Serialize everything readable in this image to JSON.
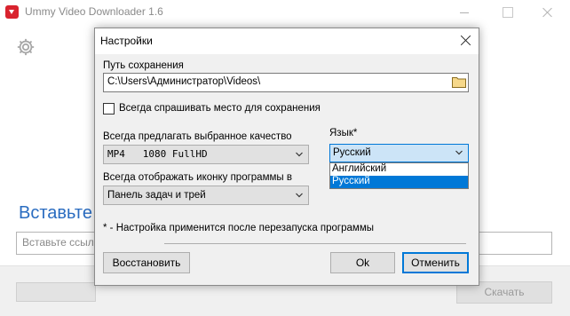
{
  "main_window": {
    "title": "Ummy Video Downloader 1.6",
    "heading": "Вставьте",
    "url_placeholder": "Вставьте ссылк",
    "download_button": "Скачать",
    "icons": {
      "app": "download-app-icon",
      "settings": "gear-icon"
    }
  },
  "settings_dialog": {
    "title": "Настройки",
    "save_path": {
      "label": "Путь сохранения",
      "value": "C:\\Users\\Администратор\\Videos\\"
    },
    "ask_location": {
      "label": "Всегда спрашивать место для сохранения",
      "checked": false
    },
    "quality": {
      "label": "Всегда предлагать выбранное качество",
      "value": "MP4   1080 FullHD"
    },
    "tray": {
      "label": "Всегда отображать иконку программы в",
      "value": "Панель задач и трей"
    },
    "language": {
      "label": "Язык*",
      "value": "Русский",
      "options": [
        "Английский",
        "Русский"
      ],
      "highlighted": "Русский"
    },
    "note": "* - Настройка применится после перезапуска программы",
    "buttons": {
      "restore": "Восстановить",
      "ok": "Ok",
      "cancel": "Отменить"
    }
  },
  "colors": {
    "accent": "#0078d7",
    "heading_blue": "#2a6cc0",
    "app_icon_red": "#d9232e",
    "dialog_bg": "#f0f0f0"
  }
}
